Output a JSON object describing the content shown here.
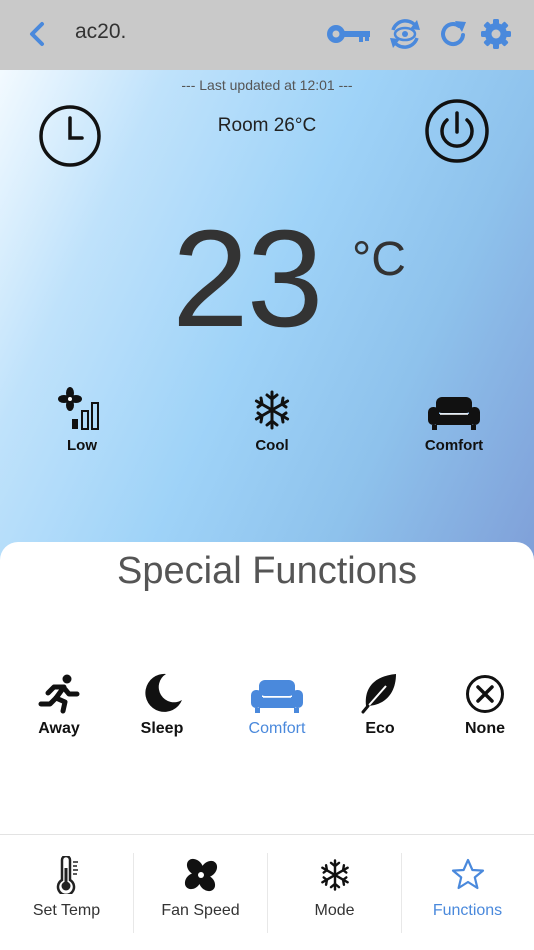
{
  "header": {
    "title": "ac20.",
    "icons": [
      "chevron-left-icon",
      "key-icon",
      "eye-sync-icon",
      "refresh-icon",
      "gear-icon"
    ]
  },
  "status_bar": {
    "last_updated": "--- Last updated at 12:01 ---",
    "room": "Room 26°C"
  },
  "temperature": {
    "value": "23",
    "unit": "°C"
  },
  "quick_status": [
    {
      "label": "Low",
      "icon": "fan-speed-icon"
    },
    {
      "label": "Cool",
      "icon": "snowflake-icon"
    },
    {
      "label": "Comfort",
      "icon": "sofa-icon"
    }
  ],
  "special_functions": {
    "title": "Special Functions",
    "items": [
      {
        "label": "Away",
        "icon": "running-person-icon"
      },
      {
        "label": "Sleep",
        "icon": "moon-icon"
      },
      {
        "label": "Comfort",
        "icon": "sofa-icon",
        "active": true
      },
      {
        "label": "Eco",
        "icon": "leaf-icon"
      },
      {
        "label": "None",
        "icon": "circle-x-icon"
      }
    ]
  },
  "bottom_nav": [
    {
      "label": "Set Temp",
      "icon": "thermometer-icon"
    },
    {
      "label": "Fan Speed",
      "icon": "fan-icon"
    },
    {
      "label": "Mode",
      "icon": "snowflake-icon"
    },
    {
      "label": "Functions",
      "icon": "star-icon",
      "active": true
    }
  ],
  "colors": {
    "accent": "#4a89dc",
    "header_bg": "#c9c9c9",
    "text_dark": "#333333"
  }
}
